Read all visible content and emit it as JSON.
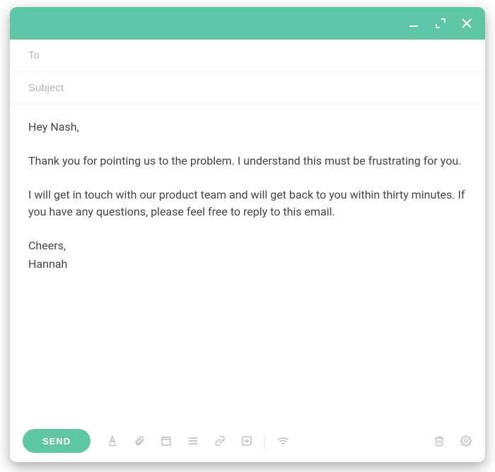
{
  "colors": {
    "accent": "#5ec6a5",
    "iconGray": "#bdbdbd",
    "placeholder": "#b3b3b3",
    "bodyText": "#444444"
  },
  "header": {
    "to_placeholder": "To",
    "to_value": "",
    "subject_placeholder": "Subject",
    "subject_value": ""
  },
  "body": {
    "paragraphs": [
      "Hey Nash,",
      "Thank you for pointing us to the problem. I understand this must be frustrating for you.",
      "I will get in touch with our product team and will get back to you within thirty minutes. If you have any questions, please feel free to reply to this email.",
      "Cheers,",
      "Hannah"
    ]
  },
  "toolbar": {
    "send_label": "SEND"
  }
}
